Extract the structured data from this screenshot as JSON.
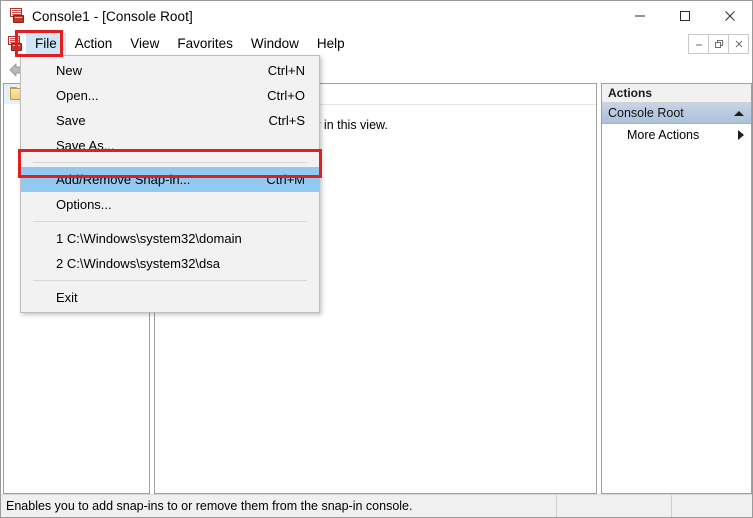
{
  "window": {
    "title": "Console1 - [Console Root]",
    "app_icon": "mmc-console-icon",
    "controls": {
      "minimize": "–",
      "maximize": "□",
      "close": "✕"
    },
    "mdi_controls": {
      "minimize": "–",
      "restore": "❐",
      "close": "✕"
    }
  },
  "menubar": {
    "items": [
      {
        "label": "File",
        "active": true
      },
      {
        "label": "Action",
        "active": false
      },
      {
        "label": "View",
        "active": false
      },
      {
        "label": "Favorites",
        "active": false
      },
      {
        "label": "Window",
        "active": false
      },
      {
        "label": "Help",
        "active": false
      }
    ]
  },
  "toolbar": {
    "back_icon": "back-arrow-icon"
  },
  "file_menu": {
    "items": [
      {
        "label": "New",
        "accel": "Ctrl+N",
        "type": "item",
        "highlight": false
      },
      {
        "label": "Open...",
        "accel": "Ctrl+O",
        "type": "item",
        "highlight": false
      },
      {
        "label": "Save",
        "accel": "Ctrl+S",
        "type": "item",
        "highlight": false
      },
      {
        "label": "Save As...",
        "accel": "",
        "type": "item",
        "highlight": false
      },
      {
        "type": "separator"
      },
      {
        "label": "Add/Remove Snap-in...",
        "accel": "Ctrl+M",
        "type": "item",
        "highlight": true
      },
      {
        "label": "Options...",
        "accel": "",
        "type": "item",
        "highlight": false
      },
      {
        "type": "separator"
      },
      {
        "label": "1 C:\\Windows\\system32\\domain",
        "accel": "",
        "type": "item",
        "highlight": false
      },
      {
        "label": "2 C:\\Windows\\system32\\dsa",
        "accel": "",
        "type": "item",
        "highlight": false
      },
      {
        "type": "separator"
      },
      {
        "label": "Exit",
        "accel": "",
        "type": "item",
        "highlight": false
      }
    ]
  },
  "tree_pane": {
    "root_node": {
      "label": "",
      "icon": "folder-icon"
    }
  },
  "list_pane": {
    "empty_message": "There are no items to show in this view."
  },
  "actions_pane": {
    "header": "Actions",
    "group": {
      "label": "Console Root",
      "collapse_icon": "chevron-up-icon"
    },
    "items": [
      {
        "label": "More Actions",
        "submenu_icon": "chevron-right-icon"
      }
    ]
  },
  "statusbar": {
    "message": "Enables you to add snap-ins to or remove them from the snap-in console.",
    "segment_2": "",
    "segment_3": ""
  },
  "colors": {
    "annotation_red": "#e02020",
    "menu_highlight_blue": "#91c9f0",
    "menubar_active_blue": "#cfe6f7",
    "actions_group_blue": "#aec1d9"
  }
}
